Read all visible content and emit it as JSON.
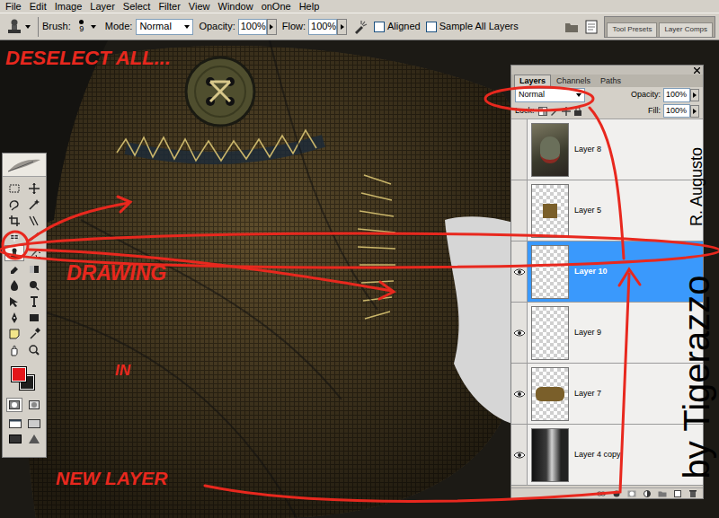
{
  "menu": [
    "File",
    "Edit",
    "Image",
    "Layer",
    "Select",
    "Filter",
    "View",
    "Window",
    "onOne",
    "Help"
  ],
  "options_bar": {
    "brush_label": "Brush:",
    "brush_size": "9",
    "mode_label": "Mode:",
    "mode": "Normal",
    "opacity_label": "Opacity:",
    "opacity": "100%",
    "flow_label": "Flow:",
    "flow": "100%",
    "aligned": {
      "label": "Aligned",
      "checked": false
    },
    "sample_all_layers": {
      "label": "Sample All Layers",
      "checked": false
    },
    "palette_well": [
      "Tool Presets",
      "Layer Comps"
    ]
  },
  "tools": [
    {
      "selected": false
    },
    {
      "selected": false
    },
    {
      "selected": false
    },
    {
      "selected": false
    },
    {
      "selected": false
    },
    {
      "selected": false
    },
    {
      "selected": false
    },
    {
      "selected": false
    },
    {
      "selected": true
    },
    {
      "selected": false
    },
    {
      "selected": false
    },
    {
      "selected": false
    },
    {
      "selected": false
    },
    {
      "selected": false
    },
    {
      "selected": false
    },
    {
      "selected": false
    },
    {
      "selected": false
    },
    {
      "selected": false
    },
    {
      "selected": false
    },
    {
      "selected": false
    },
    {
      "selected": false
    },
    {
      "selected": false
    }
  ],
  "colors": {
    "foreground": "#e3161b",
    "background": "#1e1e1e"
  },
  "layers_panel": {
    "tabs": [
      {
        "label": "Layers",
        "selected": true
      },
      {
        "label": "Channels",
        "selected": false
      },
      {
        "label": "Paths",
        "selected": false
      }
    ],
    "blend_mode": "Normal",
    "opacity_label": "Opacity:",
    "opacity": "100%",
    "lock_label": "Lock:",
    "fill_label": "Fill:",
    "fill": "100%",
    "layers": [
      {
        "name": "Layer 8",
        "visible": false,
        "selected": false,
        "kind": "portrait"
      },
      {
        "name": "Layer 5",
        "visible": false,
        "selected": false,
        "kind": "swatch"
      },
      {
        "name": "Layer 10",
        "visible": true,
        "selected": true,
        "kind": "empty"
      },
      {
        "name": "Layer 9",
        "visible": true,
        "selected": false,
        "kind": "empty"
      },
      {
        "name": "Layer 7",
        "visible": true,
        "selected": false,
        "kind": "patch"
      },
      {
        "name": "Layer 4 copy",
        "visible": true,
        "selected": false,
        "kind": "photo"
      }
    ]
  },
  "annotations": [
    "DESELECT ALL...",
    "DRAWING",
    "IN",
    "NEW LAYER"
  ],
  "watermark": {
    "credit": "by Tigerazzo",
    "author": "R. Augusto"
  }
}
